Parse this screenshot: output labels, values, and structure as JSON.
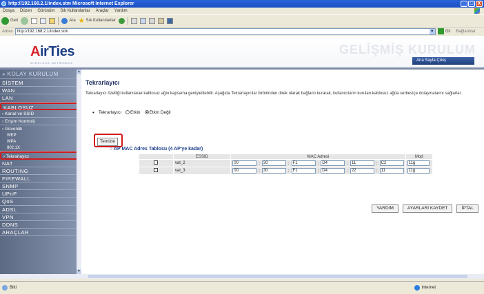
{
  "window": {
    "title": "http://192.168.2.1/index.stm  Microsoft Internet Explorer",
    "buttons": [
      "_",
      "□",
      "X"
    ]
  },
  "menubar": {
    "items": [
      "Dosya",
      "Düzen",
      "Görünüm",
      "Sık Kullanılanlar",
      "Araçlar",
      "Yardım"
    ]
  },
  "toolbar": {
    "back": "Geri",
    "search": "Ara",
    "favorites": "Sık Kullanılanlar"
  },
  "address": {
    "label": "Adres",
    "value": "http://192.168.2.1/index.stm",
    "go": "Git",
    "links": "Bağlantılar"
  },
  "banner": {
    "logo_text": "AirTies",
    "logo_sub": "WIRELESS NETWORKS",
    "title": "GELİŞMİŞ KURULUM",
    "nav": "Ana Sayfa  Çıkış"
  },
  "sidebar": {
    "items": [
      {
        "label": "» KOLAY KURULUM",
        "kind": "head"
      },
      {
        "label": "SİSTEM",
        "kind": "main"
      },
      {
        "label": "WAN",
        "kind": "main"
      },
      {
        "label": "LAN",
        "kind": "main"
      },
      {
        "label": "KABLOSUZ",
        "kind": "main",
        "active": true
      },
      {
        "label": "› Kanal ve SSID",
        "kind": "sub"
      },
      {
        "label": "› Erişim Kontrolü",
        "kind": "sub"
      },
      {
        "label": "› Güvenlik",
        "kind": "sub"
      },
      {
        "label": "WEP",
        "kind": "subsub"
      },
      {
        "label": "WPA",
        "kind": "subsub"
      },
      {
        "label": "802.1X",
        "kind": "subsub"
      },
      {
        "label": "› Tekrarlayıcı",
        "kind": "sub",
        "active": true
      },
      {
        "label": "NAT",
        "kind": "main"
      },
      {
        "label": "ROUTING",
        "kind": "main"
      },
      {
        "label": "FIREWALL",
        "kind": "main"
      },
      {
        "label": "SNMP",
        "kind": "main"
      },
      {
        "label": "UPnP",
        "kind": "main"
      },
      {
        "label": "QoS",
        "kind": "main"
      },
      {
        "label": "ADSL",
        "kind": "main"
      },
      {
        "label": "VPN",
        "kind": "main"
      },
      {
        "label": "DDNS",
        "kind": "main"
      },
      {
        "label": "ARAÇLAR",
        "kind": "main"
      }
    ]
  },
  "main": {
    "title": "Tekrarlayıcı",
    "description": "Tekrarlayıcı özelliği kullanılarak kablosuz ağın kapsama genişletilebilir. Aşağıda Tekrarlayıcılar birbirinden direk olarak bağlantı kurarak, kullanıcıların kurulan kablosuz ağda serbestçe dolaşmalarını sağlarlar.",
    "radio_label": "Tekrarlayıcı",
    "radio_on": "Etkin",
    "radio_off": "Etkin Değil",
    "clean_button": "Temizle",
    "table_title": "AP MAC Adres Tablosu (4 AP'ye kadar)",
    "headers": [
      "",
      "ESSID",
      "MAC Adresi",
      "Mod"
    ],
    "rows": [
      {
        "essid": "vat_2",
        "mac": [
          "00",
          "30",
          "F1",
          "D4",
          "11",
          "C2"
        ],
        "mode": "11g"
      },
      {
        "essid": "vat_3",
        "mac": [
          "00",
          "30",
          "F1",
          "D4",
          "22",
          "11"
        ],
        "mode": "11g"
      }
    ],
    "help_button": "YARDIM",
    "save_button": "AYARLARI KAYDET",
    "cancel_button": "İPTAL"
  },
  "status": {
    "left": "Bitti",
    "right": "Internet"
  }
}
